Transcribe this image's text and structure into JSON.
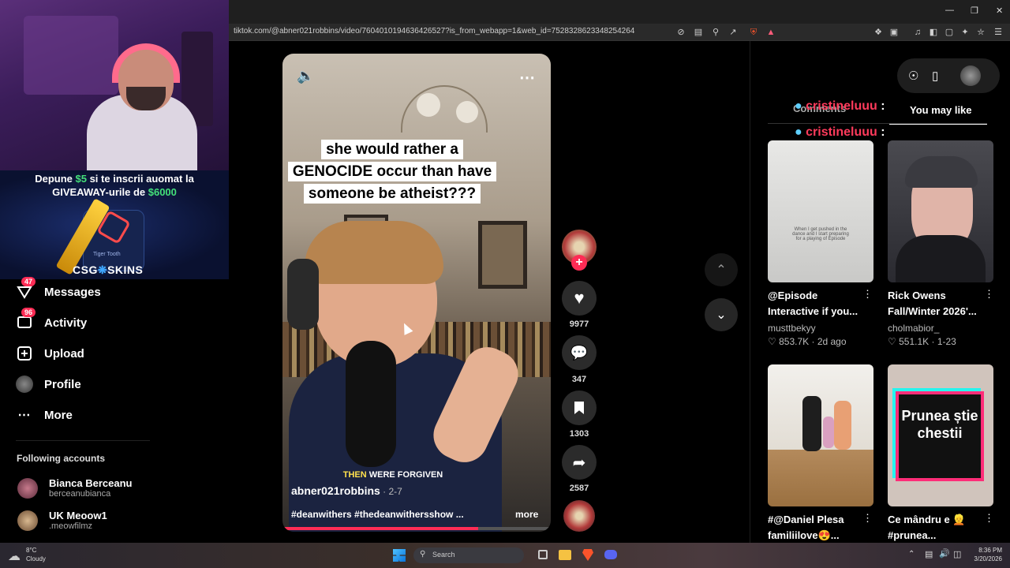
{
  "browser": {
    "url": "tiktok.com/@abner021robbins/video/7604010194636426527?is_from_webapp=1&web_id=7528328623348254264"
  },
  "overlay": {
    "promo_line1_a": "Depune ",
    "promo_amount1": "$5",
    "promo_line1_b": " si te inscrii auomat la",
    "promo_line2_a": "GIVEAWAY-urile de ",
    "promo_amount2": "$6000",
    "promo_brand_a": "CSG",
    "promo_brand_b": "SKINS",
    "promo_card_label": "Tiger Tooth"
  },
  "nav": {
    "messages": {
      "label": "Messages",
      "badge": "47"
    },
    "activity": {
      "label": "Activity",
      "badge": "96"
    },
    "upload": {
      "label": "Upload"
    },
    "profile": {
      "label": "Profile"
    },
    "more": {
      "label": "More"
    }
  },
  "following": {
    "heading": "Following accounts",
    "accounts": [
      {
        "name": "Bianca Berceanu",
        "handle": "berceanubianca"
      },
      {
        "name": "UK Meoow1",
        "handle": ".meowfilmz"
      }
    ]
  },
  "video": {
    "caption_overlay": "she would rather a GENOCIDE occur than have someone be atheist???",
    "subtitle_highlight": "THEN",
    "subtitle_rest": " WERE FORGIVEN",
    "author": "abner021robbins",
    "date": " · 2-7",
    "hashtags": "#deanwithers #thedeanwithersshow ...",
    "more": "more",
    "likes": "9977",
    "comments": "347",
    "saves": "1303",
    "shares": "2587"
  },
  "right_panel": {
    "tab_comments": "Comments",
    "tab_you_may_like": "You may like",
    "chat_user": "cristineluuu",
    "chat_colon": ":",
    "cards": [
      {
        "title": "@Episode Interactive if you...",
        "author": "musttbekyy",
        "likes": "853.7K",
        "date": "2d ago",
        "thumb_text": "When I get pushed in the dance and I start preparing for a playing of Episode"
      },
      {
        "title": "Rick Owens Fall/Winter 2026'...",
        "author": "cholmabior_",
        "likes": "551.1K",
        "date": "1-23"
      },
      {
        "title": "#@Daniel Plesa familiilove😍...",
        "author": "",
        "likes": "",
        "date": ""
      },
      {
        "title": "Ce mândru e 👱 #prunea...",
        "author": "",
        "likes": "",
        "date": "",
        "thumb_text": "Prunea știe chestii"
      }
    ]
  },
  "taskbar": {
    "weather_temp": "8°C",
    "weather_desc": "Cloudy",
    "search_placeholder": "Search",
    "time": "8:36 PM",
    "date": "3/20/2026"
  },
  "colors": {
    "accent": "#fe2c55",
    "green_money": "#44e07a",
    "chat_user": "#ff3b5c"
  }
}
